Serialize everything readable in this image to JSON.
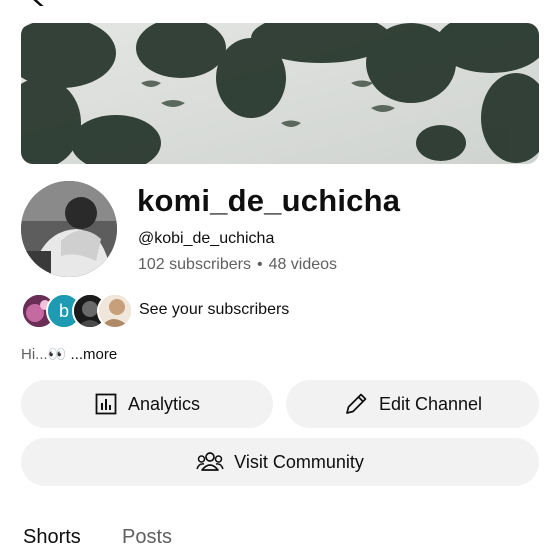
{
  "channel": {
    "name": "komi_de_uchicha",
    "handle": "@kobi_de_uchicha",
    "subscribers": "102 subscribers",
    "separator": "•",
    "videos": "48 videos"
  },
  "subscribers_row": {
    "label": "See your subscribers",
    "avatar_letter": "b"
  },
  "description": {
    "text": "Hi...👀",
    "more": " ...more"
  },
  "buttons": {
    "analytics": "Analytics",
    "edit_channel": "Edit Channel",
    "visit_community": "Visit Community"
  },
  "tabs": {
    "shorts": "Shorts",
    "posts": "Posts"
  },
  "icons": {
    "analytics": "bar-chart-icon",
    "edit": "pencil-icon",
    "community": "people-icon"
  },
  "colors": {
    "pill_bg": "#f2f2f2",
    "secondary_text": "#606060",
    "avatar_teal": "#1e9bb3"
  }
}
